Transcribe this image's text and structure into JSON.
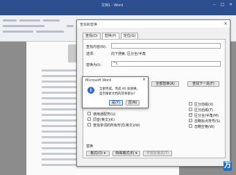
{
  "window": {
    "title": "文档1 - Word"
  },
  "dialog": {
    "title": "查找和替换",
    "close": "×",
    "tabs": [
      "查找(D)",
      "替换(P)",
      "定位(G)"
    ],
    "find_label": "查找内容(N):",
    "find_value": "",
    "options_label": "选项:",
    "options_value": "向下搜索, 区分全/半角",
    "replace_label": "替换为(I):",
    "replace_value": "^t",
    "buttons": {
      "replace_all": "全部替换(A)",
      "find_next": "查找下一处(F)"
    },
    "search_options": [
      {
        "label": "区分前缀(X)",
        "checked": false
      },
      {
        "label": "区分后缀(T)",
        "checked": false
      },
      {
        "label": "区分全/半角(M)",
        "checked": true
      },
      {
        "label": "忽略标点符号(S)",
        "checked": false
      },
      {
        "label": "忽略空格(W)",
        "checked": false
      }
    ],
    "left_options": [
      {
        "label": "使用通配符(U)",
        "checked": false
      },
      {
        "label": "同音(英文)(K)",
        "checked": false
      },
      {
        "label": "查找单词的所有形式(英文)(W)",
        "checked": false
      }
    ],
    "replace_section": "替换",
    "format_buttons": [
      "格式(O) ▾",
      "特殊格式(E) ▾",
      "不限定格式(T)"
    ]
  },
  "message_box": {
    "title": "Microsoft Word",
    "close": "×",
    "icon": "info-icon",
    "line1": "全部完成。完成 40 处替换。",
    "line2": "是否搜索文档的其余部分?",
    "yes": "是(Y)",
    "no": "否(N)"
  },
  "logo": {
    "text": "万"
  }
}
